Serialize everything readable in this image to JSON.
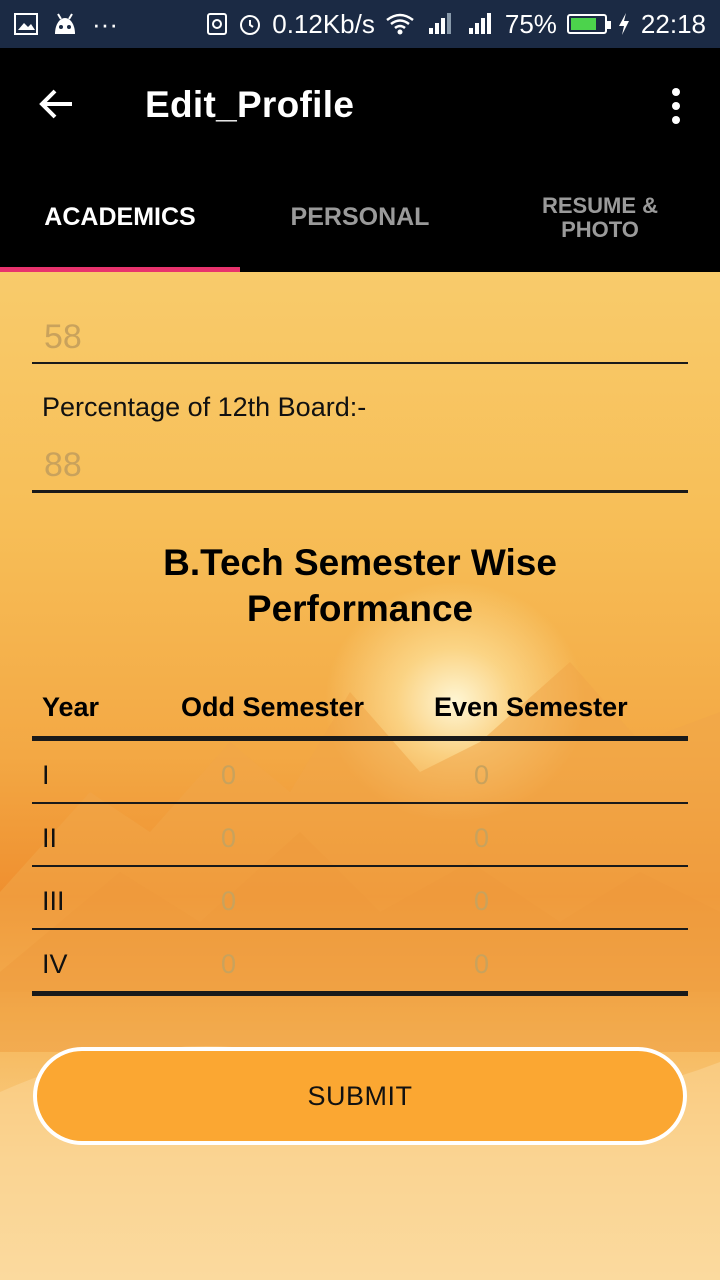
{
  "status_bar": {
    "dots": "···",
    "speed": "0.12Kb/s",
    "battery": "75%",
    "time": "22:18",
    "icons": [
      "image-icon",
      "android-icon",
      "more-icon",
      "nfc-icon",
      "alarm-icon",
      "wifi-icon",
      "signal-1-icon",
      "signal-2-icon",
      "battery-icon",
      "charging-icon"
    ]
  },
  "app_bar": {
    "title": "Edit_Profile",
    "back_icon": "arrow-left-icon",
    "menu_icon": "more-vert-icon"
  },
  "tabs": [
    {
      "label": "ACADEMICS",
      "active": true
    },
    {
      "label": "PERSONAL",
      "active": false
    },
    {
      "label": "RESUME & PHOTO",
      "active": false
    }
  ],
  "form": {
    "tenth_value": "58",
    "twelfth_label": "Percentage of 12th Board:-",
    "twelfth_value": "88"
  },
  "performance": {
    "title_line1": "B.Tech Semester Wise",
    "title_line2": "Performance",
    "headers": {
      "year": "Year",
      "odd": "Odd Semester",
      "even": "Even Semester"
    },
    "rows": [
      {
        "year": "I",
        "odd": "0",
        "even": "0"
      },
      {
        "year": "II",
        "odd": "0",
        "even": "0"
      },
      {
        "year": "III",
        "odd": "0",
        "even": "0"
      },
      {
        "year": "IV",
        "odd": "0",
        "even": "0"
      }
    ]
  },
  "submit_label": "SUBMIT",
  "colors": {
    "tab_indicator": "#e8336d",
    "submit_fill": "#fba732",
    "value_text": "#c9a25c"
  }
}
